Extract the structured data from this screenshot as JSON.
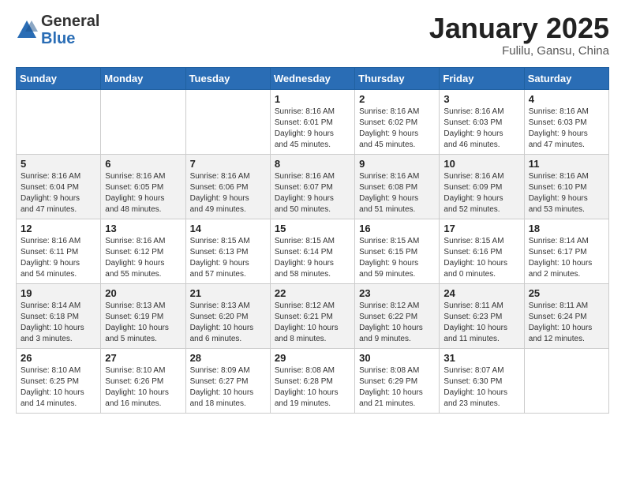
{
  "header": {
    "logo_general": "General",
    "logo_blue": "Blue",
    "title": "January 2025",
    "subtitle": "Fulilu, Gansu, China"
  },
  "weekdays": [
    "Sunday",
    "Monday",
    "Tuesday",
    "Wednesday",
    "Thursday",
    "Friday",
    "Saturday"
  ],
  "weeks": [
    [
      {
        "day": "",
        "info": ""
      },
      {
        "day": "",
        "info": ""
      },
      {
        "day": "",
        "info": ""
      },
      {
        "day": "1",
        "info": "Sunrise: 8:16 AM\nSunset: 6:01 PM\nDaylight: 9 hours\nand 45 minutes."
      },
      {
        "day": "2",
        "info": "Sunrise: 8:16 AM\nSunset: 6:02 PM\nDaylight: 9 hours\nand 45 minutes."
      },
      {
        "day": "3",
        "info": "Sunrise: 8:16 AM\nSunset: 6:03 PM\nDaylight: 9 hours\nand 46 minutes."
      },
      {
        "day": "4",
        "info": "Sunrise: 8:16 AM\nSunset: 6:03 PM\nDaylight: 9 hours\nand 47 minutes."
      }
    ],
    [
      {
        "day": "5",
        "info": "Sunrise: 8:16 AM\nSunset: 6:04 PM\nDaylight: 9 hours\nand 47 minutes."
      },
      {
        "day": "6",
        "info": "Sunrise: 8:16 AM\nSunset: 6:05 PM\nDaylight: 9 hours\nand 48 minutes."
      },
      {
        "day": "7",
        "info": "Sunrise: 8:16 AM\nSunset: 6:06 PM\nDaylight: 9 hours\nand 49 minutes."
      },
      {
        "day": "8",
        "info": "Sunrise: 8:16 AM\nSunset: 6:07 PM\nDaylight: 9 hours\nand 50 minutes."
      },
      {
        "day": "9",
        "info": "Sunrise: 8:16 AM\nSunset: 6:08 PM\nDaylight: 9 hours\nand 51 minutes."
      },
      {
        "day": "10",
        "info": "Sunrise: 8:16 AM\nSunset: 6:09 PM\nDaylight: 9 hours\nand 52 minutes."
      },
      {
        "day": "11",
        "info": "Sunrise: 8:16 AM\nSunset: 6:10 PM\nDaylight: 9 hours\nand 53 minutes."
      }
    ],
    [
      {
        "day": "12",
        "info": "Sunrise: 8:16 AM\nSunset: 6:11 PM\nDaylight: 9 hours\nand 54 minutes."
      },
      {
        "day": "13",
        "info": "Sunrise: 8:16 AM\nSunset: 6:12 PM\nDaylight: 9 hours\nand 55 minutes."
      },
      {
        "day": "14",
        "info": "Sunrise: 8:15 AM\nSunset: 6:13 PM\nDaylight: 9 hours\nand 57 minutes."
      },
      {
        "day": "15",
        "info": "Sunrise: 8:15 AM\nSunset: 6:14 PM\nDaylight: 9 hours\nand 58 minutes."
      },
      {
        "day": "16",
        "info": "Sunrise: 8:15 AM\nSunset: 6:15 PM\nDaylight: 9 hours\nand 59 minutes."
      },
      {
        "day": "17",
        "info": "Sunrise: 8:15 AM\nSunset: 6:16 PM\nDaylight: 10 hours\nand 0 minutes."
      },
      {
        "day": "18",
        "info": "Sunrise: 8:14 AM\nSunset: 6:17 PM\nDaylight: 10 hours\nand 2 minutes."
      }
    ],
    [
      {
        "day": "19",
        "info": "Sunrise: 8:14 AM\nSunset: 6:18 PM\nDaylight: 10 hours\nand 3 minutes."
      },
      {
        "day": "20",
        "info": "Sunrise: 8:13 AM\nSunset: 6:19 PM\nDaylight: 10 hours\nand 5 minutes."
      },
      {
        "day": "21",
        "info": "Sunrise: 8:13 AM\nSunset: 6:20 PM\nDaylight: 10 hours\nand 6 minutes."
      },
      {
        "day": "22",
        "info": "Sunrise: 8:12 AM\nSunset: 6:21 PM\nDaylight: 10 hours\nand 8 minutes."
      },
      {
        "day": "23",
        "info": "Sunrise: 8:12 AM\nSunset: 6:22 PM\nDaylight: 10 hours\nand 9 minutes."
      },
      {
        "day": "24",
        "info": "Sunrise: 8:11 AM\nSunset: 6:23 PM\nDaylight: 10 hours\nand 11 minutes."
      },
      {
        "day": "25",
        "info": "Sunrise: 8:11 AM\nSunset: 6:24 PM\nDaylight: 10 hours\nand 12 minutes."
      }
    ],
    [
      {
        "day": "26",
        "info": "Sunrise: 8:10 AM\nSunset: 6:25 PM\nDaylight: 10 hours\nand 14 minutes."
      },
      {
        "day": "27",
        "info": "Sunrise: 8:10 AM\nSunset: 6:26 PM\nDaylight: 10 hours\nand 16 minutes."
      },
      {
        "day": "28",
        "info": "Sunrise: 8:09 AM\nSunset: 6:27 PM\nDaylight: 10 hours\nand 18 minutes."
      },
      {
        "day": "29",
        "info": "Sunrise: 8:08 AM\nSunset: 6:28 PM\nDaylight: 10 hours\nand 19 minutes."
      },
      {
        "day": "30",
        "info": "Sunrise: 8:08 AM\nSunset: 6:29 PM\nDaylight: 10 hours\nand 21 minutes."
      },
      {
        "day": "31",
        "info": "Sunrise: 8:07 AM\nSunset: 6:30 PM\nDaylight: 10 hours\nand 23 minutes."
      },
      {
        "day": "",
        "info": ""
      }
    ]
  ]
}
